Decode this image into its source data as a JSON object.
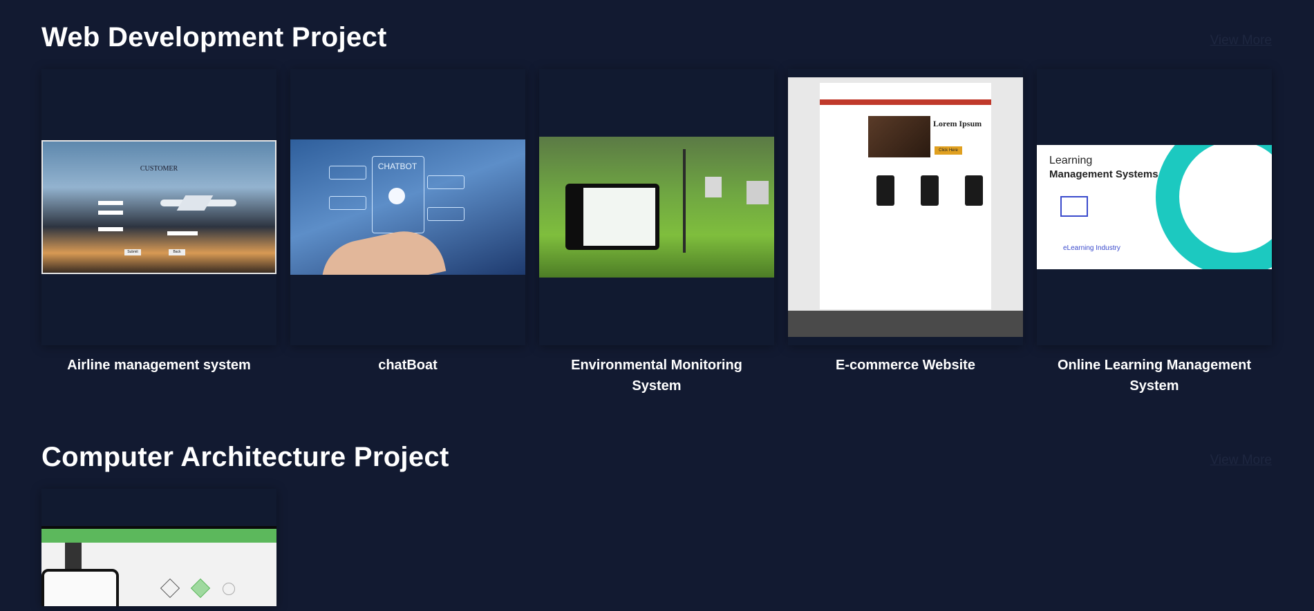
{
  "sections": [
    {
      "title": "Web Development Project",
      "view_more": "View More",
      "cards": [
        {
          "label": "Airline management system",
          "image": {
            "caption": "CUSTOMER",
            "buttons": [
              "Submit",
              "Back"
            ]
          }
        },
        {
          "label": "chatBoat",
          "image": {
            "caption": "CHATBOT"
          }
        },
        {
          "label": "Environmental Monitoring System"
        },
        {
          "label": "E-commerce Website",
          "image": {
            "promo_title": "Lorem Ipsum",
            "promo_button": "Click Here"
          }
        },
        {
          "label": "Online Learning Management System",
          "image": {
            "line1": "Learning",
            "line2": "Management Systems",
            "brand": "eLearning Industry"
          }
        }
      ]
    },
    {
      "title": "Computer Architecture Project",
      "view_more": "View More"
    }
  ]
}
